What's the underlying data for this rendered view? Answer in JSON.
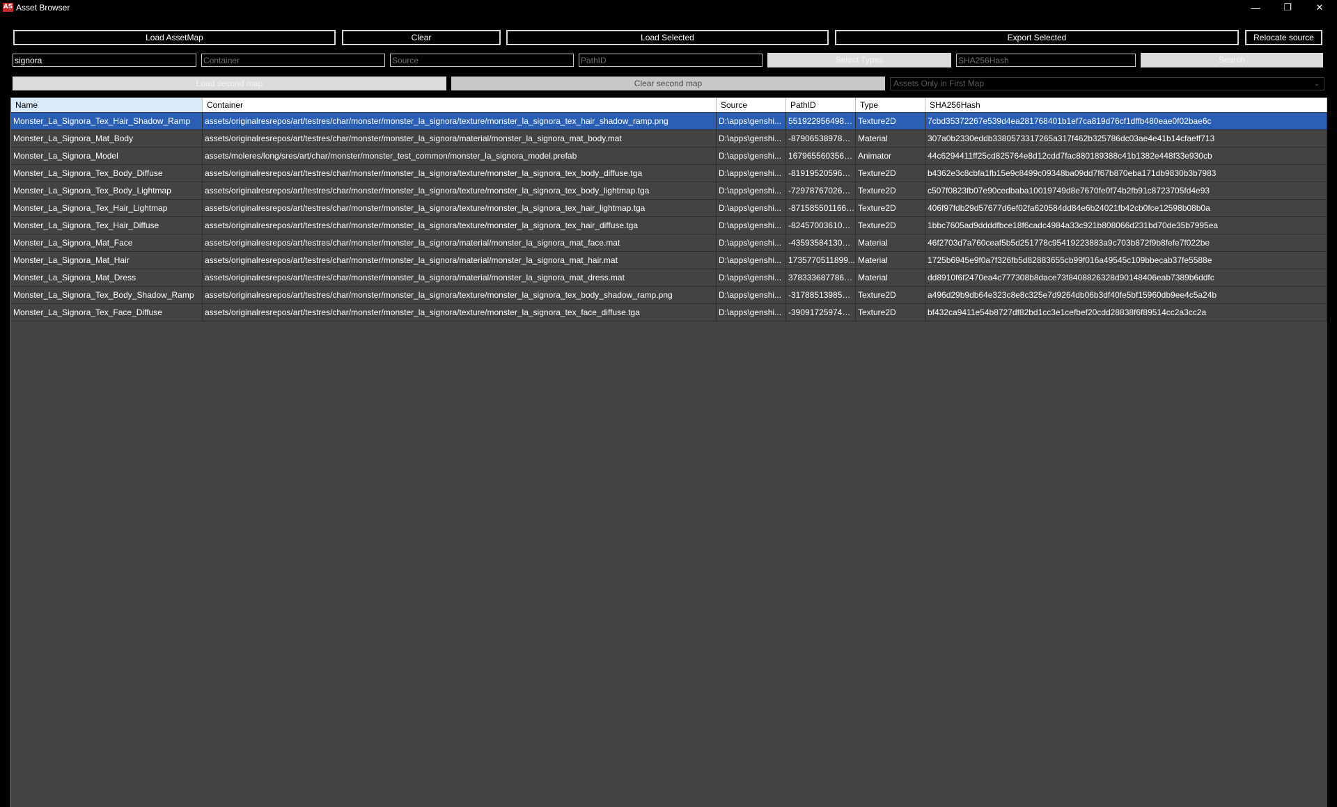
{
  "window": {
    "app_icon_text": "AS",
    "title": "Asset Browser",
    "minimize_glyph": "—",
    "maximize_glyph": "❐",
    "close_glyph": "✕"
  },
  "toolbar": {
    "load_assetmap": "Load AssetMap",
    "clear": "Clear",
    "load_selected": "Load Selected",
    "export_selected": "Export Selected",
    "relocate_source": "Relocate source"
  },
  "filters": {
    "name_value": "signora",
    "container_placeholder": "Container",
    "source_placeholder": "Source",
    "pathid_placeholder": "PathID",
    "select_types": "Select Types",
    "sha_placeholder": "SHA256Hash",
    "search": "Search"
  },
  "second_map": {
    "load": "Load second map",
    "clear": "Clear second map",
    "mode_selected": "Assets Only in First Map"
  },
  "table": {
    "headers": [
      "Name",
      "Container",
      "Source",
      "PathID",
      "Type",
      "SHA256Hash"
    ],
    "selected_row": 0,
    "rows": [
      [
        "Monster_La_Signora_Tex_Hair_Shadow_Ramp",
        "assets/originalresrepos/art/testres/char/monster/monster_la_signora/texture/monster_la_signora_tex_hair_shadow_ramp.png",
        "D:\\apps\\genshi...",
        "5519229564981...",
        "Texture2D",
        "7cbd35372267e539d4ea281768401b1ef7ca819d76cf1dffb480eae0f02bae6c"
      ],
      [
        "Monster_La_Signora_Mat_Body",
        "assets/originalresrepos/art/testres/char/monster/monster_la_signora/material/monster_la_signora_mat_body.mat",
        "D:\\apps\\genshi...",
        "-8790653897870...",
        "Material",
        "307a0b2330eddb3380573317265a317f462b325786dc03ae4e41b14cfaeff713"
      ],
      [
        "Monster_La_Signora_Model",
        "assets/moleres/long/sres/art/char/monster/monster_test_common/monster_la_signora_model.prefab",
        "D:\\apps\\genshi...",
        "1679655603564...",
        "Animator",
        "44c6294411ff25cd825764e8d12cdd7fac880189388c41b1382e448f33e930cb"
      ],
      [
        "Monster_La_Signora_Tex_Body_Diffuse",
        "assets/originalresrepos/art/testres/char/monster/monster_la_signora/texture/monster_la_signora_tex_body_diffuse.tga",
        "D:\\apps\\genshi...",
        "-8191952059642...",
        "Texture2D",
        "b4362e3c8cbfa1fb15e9c8499c09348ba09dd7f67b870eba171db9830b3b7983"
      ],
      [
        "Monster_La_Signora_Tex_Body_Lightmap",
        "assets/originalresrepos/art/testres/char/monster/monster_la_signora/texture/monster_la_signora_tex_body_lightmap.tga",
        "D:\\apps\\genshi...",
        "-7297876702665...",
        "Texture2D",
        "c507f0823fb07e90cedbaba10019749d8e7670fe0f74b2fb91c8723705fd4e93"
      ],
      [
        "Monster_La_Signora_Tex_Hair_Lightmap",
        "assets/originalresrepos/art/testres/char/monster/monster_la_signora/texture/monster_la_signora_tex_hair_lightmap.tga",
        "D:\\apps\\genshi...",
        "-8715855011664...",
        "Texture2D",
        "406f97fdb29d57677d6ef02fa620584dd84e6b24021fb42cb0fce12598b08b0a"
      ],
      [
        "Monster_La_Signora_Tex_Hair_Diffuse",
        "assets/originalresrepos/art/testres/char/monster/monster_la_signora/texture/monster_la_signora_tex_hair_diffuse.tga",
        "D:\\apps\\genshi...",
        "-8245700361065...",
        "Texture2D",
        "1bbc7605ad9ddddfbce18f6cadc4984a33c921b808066d231bd70de35b7995ea"
      ],
      [
        "Monster_La_Signora_Mat_Face",
        "assets/originalresrepos/art/testres/char/monster/monster_la_signora/material/monster_la_signora_mat_face.mat",
        "D:\\apps\\genshi...",
        "-4359358413001...",
        "Material",
        "46f2703d7a760ceaf5b5d251778c95419223883a9c703b872f9b8fefe7f022be"
      ],
      [
        "Monster_La_Signora_Mat_Hair",
        "assets/originalresrepos/art/testres/char/monster/monster_la_signora/material/monster_la_signora_mat_hair.mat",
        "D:\\apps\\genshi...",
        "1735770511899...",
        "Material",
        "1725b6945e9f0a7f326fb5d82883655cb99f016a49545c109bbecab37fe5588e"
      ],
      [
        "Monster_La_Signora_Mat_Dress",
        "assets/originalresrepos/art/testres/char/monster/monster_la_signora/material/monster_la_signora_mat_dress.mat",
        "D:\\apps\\genshi...",
        "3783336877860...",
        "Material",
        "dd8910f6f2470ea4c777308b8dace73f8408826328d90148406eab7389b6ddfc"
      ],
      [
        "Monster_La_Signora_Tex_Body_Shadow_Ramp",
        "assets/originalresrepos/art/testres/char/monster/monster_la_signora/texture/monster_la_signora_tex_body_shadow_ramp.png",
        "D:\\apps\\genshi...",
        "-3178851398526...",
        "Texture2D",
        "a496d29b9db64e323c8e8c325e7d9264db06b3df40fe5bf15960db9ee4c5a24b"
      ],
      [
        "Monster_La_Signora_Tex_Face_Diffuse",
        "assets/originalresrepos/art/testres/char/monster/monster_la_signora/texture/monster_la_signora_tex_face_diffuse.tga",
        "D:\\apps\\genshi...",
        "-3909172597406...",
        "Texture2D",
        "bf432ca9411e54b8727df82bd1cc3e1cefbef20cdd28838f6f89514cc2a3cc2a"
      ]
    ]
  }
}
